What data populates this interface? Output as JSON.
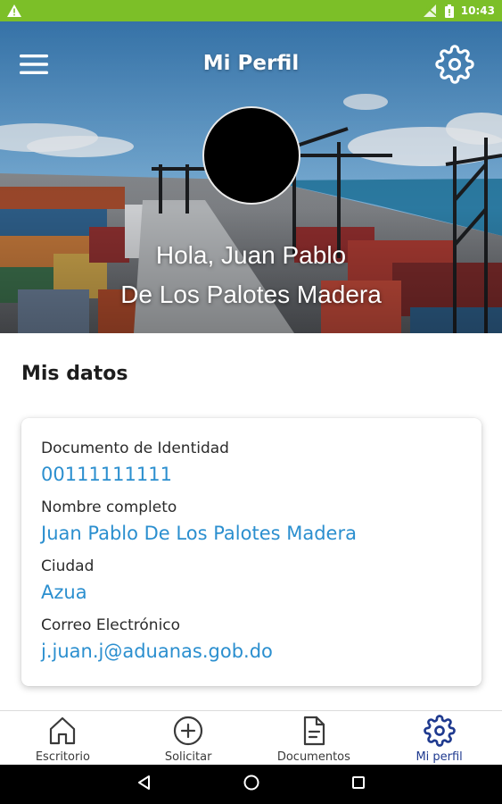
{
  "status_bar": {
    "time": "10:43",
    "icons": [
      "warning-icon",
      "signal-off-icon",
      "battery-icon"
    ],
    "color": "#7cbf28"
  },
  "header": {
    "title": "Mi Perfil",
    "menu_icon": "menu-icon",
    "settings_icon": "gear-icon"
  },
  "profile": {
    "greeting_line1": "Hola, Juan Pablo",
    "greeting_line2": "De Los Palotes Madera"
  },
  "section": {
    "title": "Mis datos"
  },
  "fields": [
    {
      "label": "Documento de Identidad",
      "value": "00111111111"
    },
    {
      "label": "Nombre completo",
      "value": "Juan Pablo De Los Palotes Madera"
    },
    {
      "label": "Ciudad",
      "value": "Azua"
    },
    {
      "label": "Correo Electrónico",
      "value": "j.juan.j@aduanas.gob.do"
    }
  ],
  "bottom_nav": {
    "items": [
      {
        "label": "Escritorio",
        "icon": "home-icon"
      },
      {
        "label": "Solicitar",
        "icon": "plus-circle-icon"
      },
      {
        "label": "Documentos",
        "icon": "document-icon"
      },
      {
        "label": "Mi perfil",
        "icon": "gear-icon",
        "active": true
      }
    ],
    "active_color": "#1f3a8f"
  },
  "system_nav": {
    "icons": [
      "back-icon",
      "home-circle-icon",
      "recents-icon"
    ]
  },
  "colors": {
    "accent": "#2b8fcf",
    "status_bar": "#7cbf28"
  }
}
